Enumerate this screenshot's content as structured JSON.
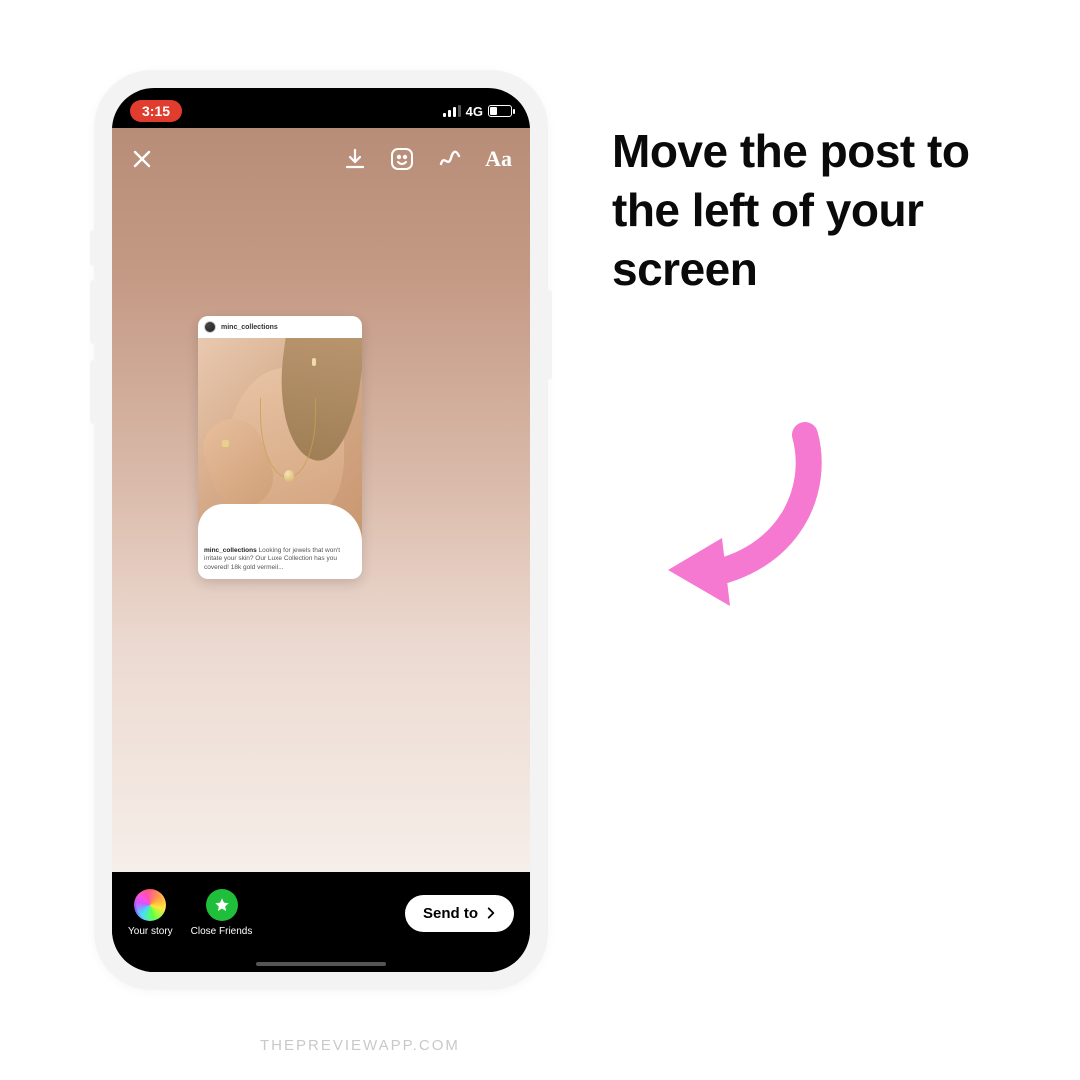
{
  "instruction_text": "Move the post to the left of your screen",
  "watermark": "THEPREVIEWAPP.COM",
  "status": {
    "time": "3:15",
    "network": "4G"
  },
  "toolbar": {
    "close_icon": "close",
    "download_icon": "download",
    "sticker_icon": "sticker",
    "draw_icon": "squiggle",
    "text_tool": "Aa"
  },
  "post": {
    "username": "minc_collections",
    "caption_user": "minc_collections",
    "caption_text": "Looking for jewels that won't irritate your skin? Our Luxe Collection has you covered! 18k gold vermeil..."
  },
  "bottom": {
    "your_story": "Your story",
    "close_friends": "Close Friends",
    "send_to": "Send to"
  },
  "colors": {
    "arrow": "#f578d1",
    "record_pill": "#e03d2f",
    "close_friends": "#1fbf3b"
  }
}
